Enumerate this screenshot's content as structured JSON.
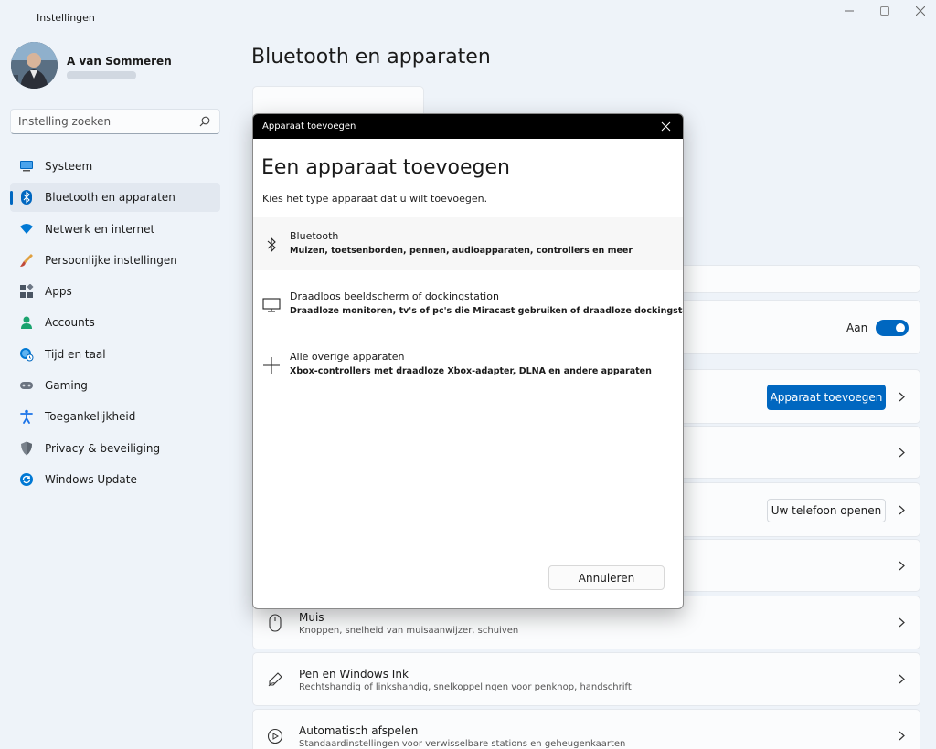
{
  "window": {
    "title": "Instellingen",
    "controls": [
      "minimize-icon",
      "maximize-icon",
      "close-icon"
    ]
  },
  "profile": {
    "name": "A van Sommeren"
  },
  "search": {
    "placeholder": "Instelling zoeken",
    "icon": "search-icon"
  },
  "sidebar": {
    "items": [
      {
        "label": "Systeem",
        "icon": "monitor-icon",
        "color": "#0067c0"
      },
      {
        "label": "Bluetooth en apparaten",
        "icon": "bluetooth-icon",
        "color": "#0067c0",
        "active": true
      },
      {
        "label": "Netwerk en internet",
        "icon": "wifi-icon",
        "color": "#0078d4"
      },
      {
        "label": "Persoonlijke instellingen",
        "icon": "brush-icon",
        "color": "#c86a2a"
      },
      {
        "label": "Apps",
        "icon": "apps-icon",
        "color": "#4a5563"
      },
      {
        "label": "Accounts",
        "icon": "person-icon",
        "color": "#1aa36f"
      },
      {
        "label": "Tijd en taal",
        "icon": "globe-clock-icon",
        "color": "#0078d4"
      },
      {
        "label": "Gaming",
        "icon": "gamepad-icon",
        "color": "#6b7380"
      },
      {
        "label": "Toegankelijkheid",
        "icon": "accessibility-icon",
        "color": "#1a73e8"
      },
      {
        "label": "Privacy & beveiliging",
        "icon": "shield-icon",
        "color": "#7a828c"
      },
      {
        "label": "Windows Update",
        "icon": "update-icon",
        "color": "#0078d4"
      }
    ]
  },
  "main": {
    "title": "Bluetooth en apparaten",
    "bluetooth_toggle_label": "Aan",
    "add_device_button": "Apparaat toevoegen",
    "phone_button": "Uw telefoon openen",
    "mouse": {
      "title": "Muis",
      "subtitle": "Knoppen, snelheid van muisaanwijzer, schuiven",
      "icon": "mouse-icon"
    },
    "pen": {
      "title": "Pen en Windows Ink",
      "subtitle": "Rechtshandig of linkshandig, snelkoppelingen voor penknop, handschrift",
      "icon": "pen-icon"
    },
    "autoplay": {
      "title": "Automatisch afspelen",
      "subtitle": "Standaardinstellingen voor verwisselbare stations en geheugenkaarten",
      "icon": "autoplay-icon"
    }
  },
  "dialog": {
    "titlebar": "Apparaat toevoegen",
    "heading": "Een apparaat toevoegen",
    "intro": "Kies het type apparaat dat u wilt toevoegen.",
    "options": [
      {
        "title": "Bluetooth",
        "description": "Muizen, toetsenborden, pennen, audioapparaten, controllers en meer",
        "icon": "bluetooth-icon"
      },
      {
        "title": "Draadloos beeldscherm of dockingstation",
        "description": "Draadloze monitoren, tv's of pc's die Miracast gebruiken of draadloze dockingstations",
        "icon": "display-icon"
      },
      {
        "title": "Alle overige apparaten",
        "description": "Xbox-controllers met draadloze Xbox-adapter, DLNA en andere apparaten",
        "icon": "plus-icon"
      }
    ],
    "cancel": "Annuleren"
  }
}
